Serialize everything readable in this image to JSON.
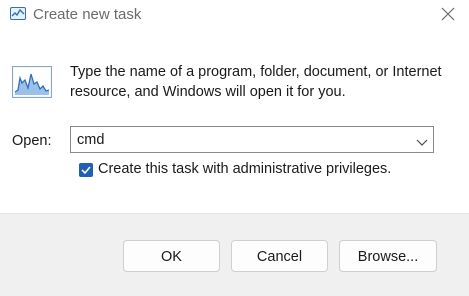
{
  "window": {
    "title": "Create new task"
  },
  "body": {
    "description": "Type the name of a program, folder, document, or Internet resource, and Windows will open it for you.",
    "open_label": "Open:",
    "open_value": "cmd",
    "admin_label": "Create this task with administrative privileges.",
    "admin_checked": true
  },
  "buttons": {
    "ok": "OK",
    "cancel": "Cancel",
    "browse": "Browse..."
  },
  "icons": {
    "title": "task-manager-icon",
    "run": "run-program-icon",
    "close": "close-icon",
    "dropdown": "chevron-down-icon",
    "check": "checkmark-icon"
  },
  "colors": {
    "accent": "#1f5fb4",
    "footer_bg": "#f0f0f0"
  }
}
